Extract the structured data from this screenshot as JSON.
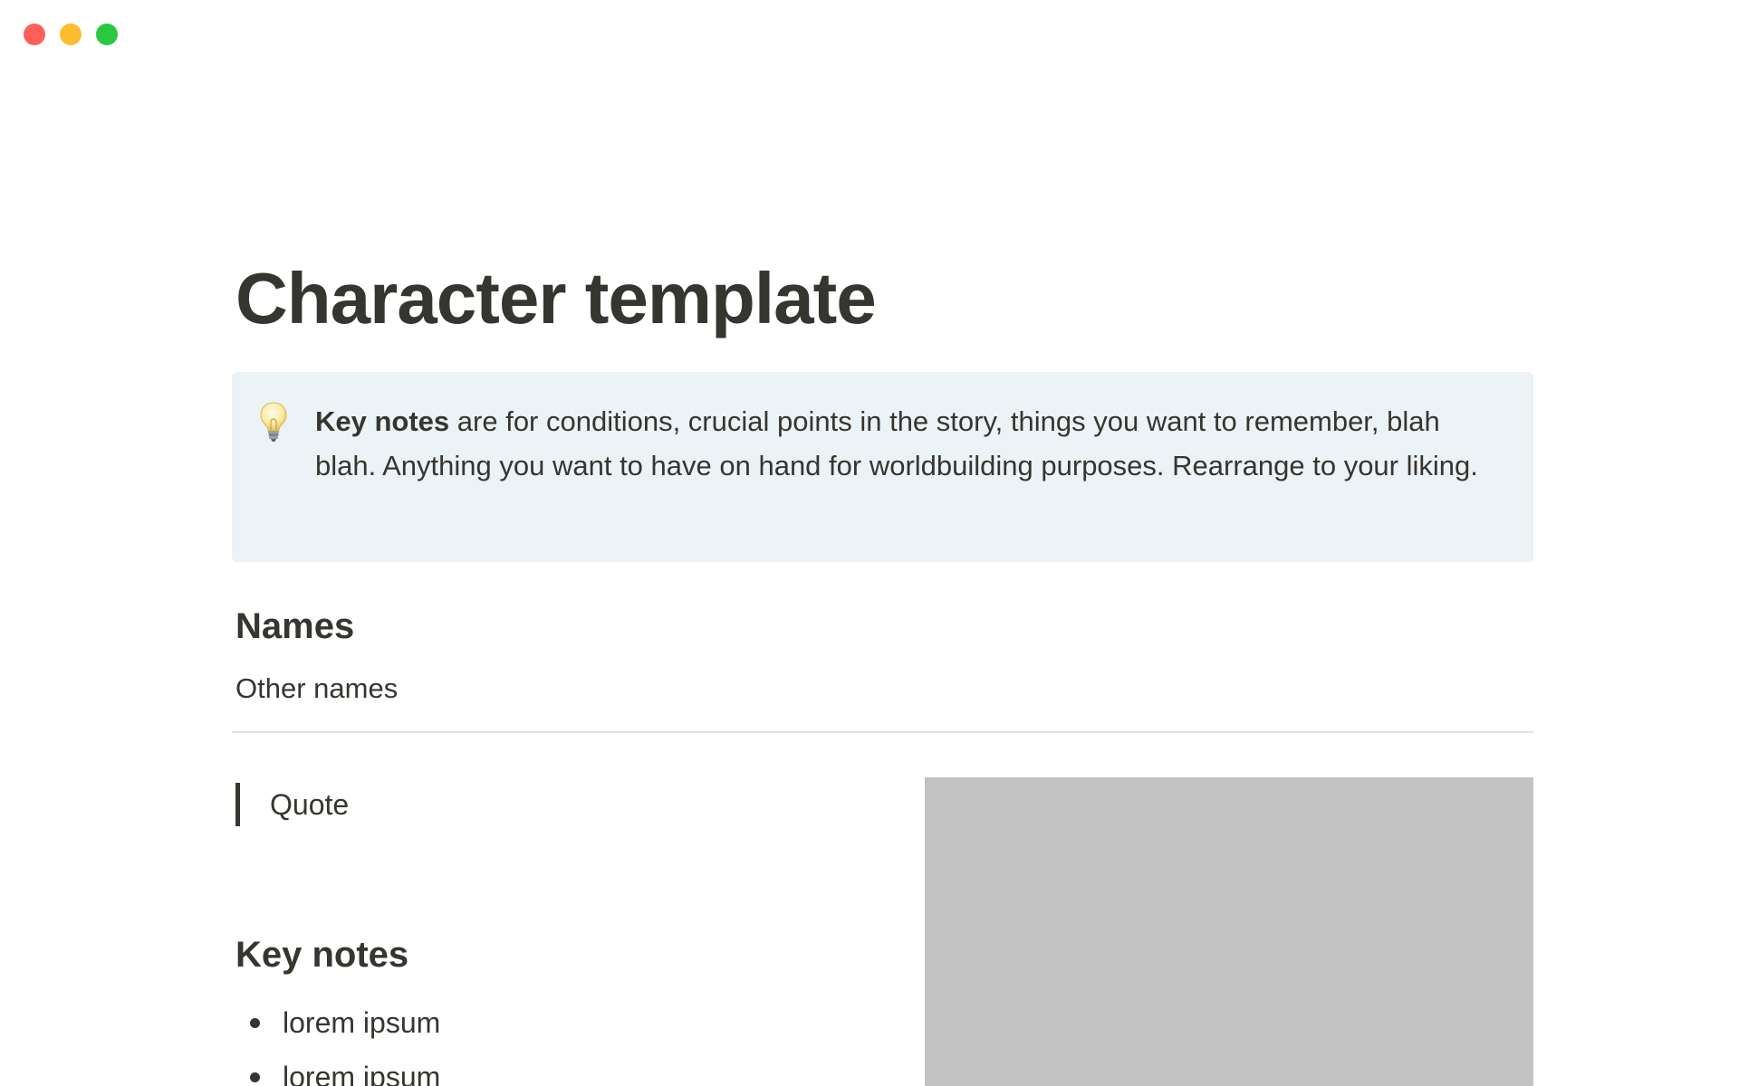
{
  "window": {
    "controls": [
      "close",
      "minimize",
      "zoom"
    ]
  },
  "page": {
    "title": "Character template",
    "callout": {
      "icon": "lightbulb-icon",
      "bold_text": "Key notes",
      "text": " are for conditions, crucial points in the story, things you want to remember, blah blah. Anything you want to have on hand for worldbuilding purposes. Rearrange to your liking."
    },
    "names_heading": "Names",
    "other_names": "Other names",
    "quote": "Quote",
    "key_notes_heading": "Key notes",
    "key_notes": [
      "lorem ipsum",
      "lorem ipsum"
    ]
  },
  "colors": {
    "text": "#37352f",
    "callout_bg": "#ebf3f7",
    "image_placeholder": "#c2c2c2",
    "divider": "#e3e2e0",
    "close": "#ff5f57",
    "minimize": "#febc2e",
    "zoom": "#28c840"
  }
}
